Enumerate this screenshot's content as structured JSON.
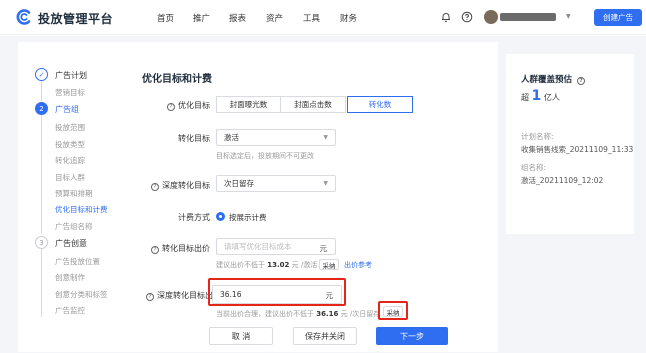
{
  "header": {
    "brand": "投放管理平台",
    "nav": [
      "首页",
      "推广",
      "报表",
      "资产",
      "工具",
      "财务"
    ],
    "create_button": "创建广告"
  },
  "steps": [
    {
      "index": "✓",
      "title": "广告计划",
      "status": "done",
      "substeps": [
        "营销目标"
      ]
    },
    {
      "index": "2",
      "title": "广告组",
      "status": "active",
      "substeps": [
        "投放范围",
        "投放类型",
        "转化追踪",
        "目标人群",
        "预算和排期",
        "优化目标和计费",
        "广告组名称"
      ]
    },
    {
      "index": "3",
      "title": "广告创意",
      "status": "pending",
      "substeps": [
        "广告投放位置",
        "创意制作",
        "创意分类和标签",
        "广告监控"
      ]
    }
  ],
  "form": {
    "section_title": "优化目标和计费",
    "optimize_goal": {
      "label": "优化目标",
      "options": [
        "封面曝光数",
        "封面点击数",
        "转化数"
      ],
      "selected": "转化数"
    },
    "conversion_goal": {
      "label": "转化目标",
      "value": "激活",
      "hint": "目标选定后，投放期间不可更改"
    },
    "deep_conversion_goal": {
      "label": "深度转化目标",
      "value": "次日留存"
    },
    "billing": {
      "label": "计费方式",
      "value": "按展示计费"
    },
    "conversion_bid": {
      "label": "转化目标出价",
      "placeholder": "请填写优化目标成本",
      "unit": "元",
      "hint_prefix": "建议出价不低于",
      "hint_value": "13.02",
      "hint_suffix": "元 /激活",
      "adopt_button": "采纳",
      "reference_link": "出价参考"
    },
    "deep_conversion_bid": {
      "label": "深度转化目标出价",
      "value": "36.16",
      "unit": "元",
      "hint_prefix": "当前出价合理，建议出价不低于",
      "hint_value": "36.16",
      "hint_suffix": "元 /次日留存",
      "adopt_button": "采纳"
    }
  },
  "footer": {
    "cancel": "取 消",
    "save_close": "保存并关闭",
    "next": "下一步"
  },
  "estimate": {
    "title": "人群覆盖预估",
    "prefix": "超",
    "number": "1",
    "suffix": "亿人",
    "plan_name_label": "计划名称:",
    "plan_name": "收集销售线索_20211109_11:33",
    "group_name_label": "组名称:",
    "group_name": "激活_20211109_12:02"
  },
  "colors": {
    "accent": "#2f6ef0",
    "highlight_box": "#e3261a"
  }
}
